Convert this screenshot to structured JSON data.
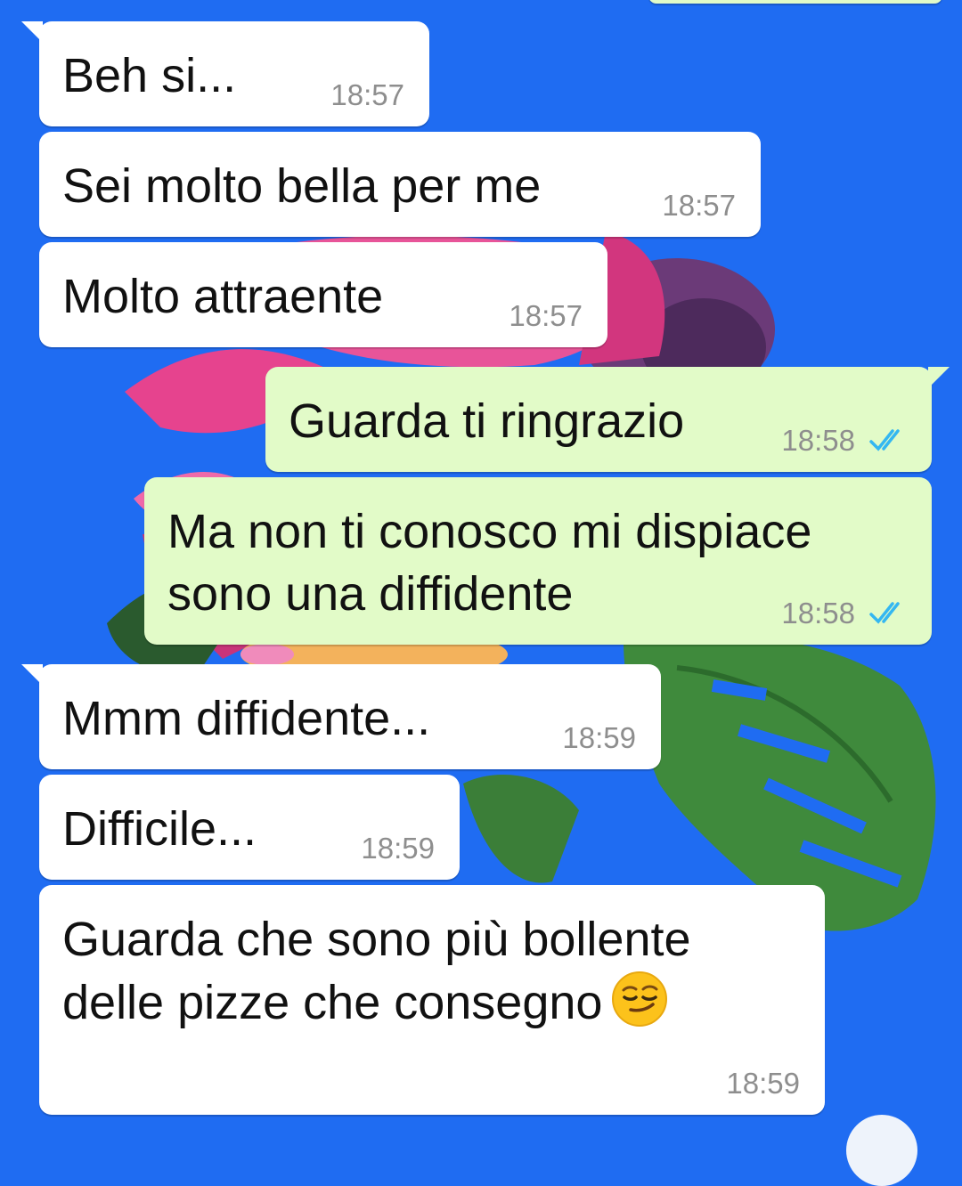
{
  "chat": {
    "messages": [
      {
        "text": "Beh si...",
        "time": "18:57",
        "direction": "in"
      },
      {
        "text": "Sei molto bella per me",
        "time": "18:57",
        "direction": "in"
      },
      {
        "text": "Molto attraente",
        "time": "18:57",
        "direction": "in"
      },
      {
        "text": "Guarda ti ringrazio",
        "time": "18:58",
        "direction": "out",
        "status": "read"
      },
      {
        "text": "Ma non ti conosco mi dispiace\nsono una diffidente",
        "time": "18:58",
        "direction": "out",
        "status": "read"
      },
      {
        "text": "Mmm diffidente...",
        "time": "18:59",
        "direction": "in"
      },
      {
        "text": "Difficile...",
        "time": "18:59",
        "direction": "in"
      },
      {
        "text": "Guarda che sono più bollente\ndelle pizze che consegno",
        "time": "18:59",
        "direction": "in",
        "emoji": "smirking-face"
      }
    ]
  },
  "theme": {
    "wallpaper_color": "#1f6cf2",
    "incoming_bubble_color": "#ffffff",
    "outgoing_bubble_color": "#e2fbc8",
    "read_tick_color": "#34b7f1"
  },
  "icons": {
    "read_receipt": "double-check-icon",
    "scroll_down": "scroll-down-button"
  }
}
